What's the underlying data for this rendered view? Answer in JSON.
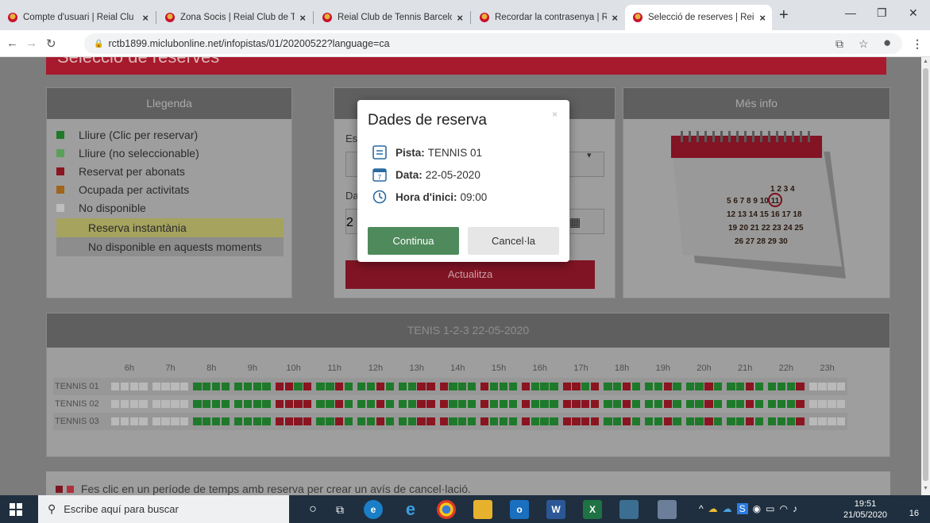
{
  "browser": {
    "tabs": [
      {
        "title": "Compte d'usuari | Reial Clu",
        "active": false
      },
      {
        "title": "Zona Socis | Reial Club de T",
        "active": false
      },
      {
        "title": "Reial Club de Tennis Barcelo",
        "active": false
      },
      {
        "title": "Recordar la contrasenya | Re",
        "active": false
      },
      {
        "title": "Selecció de reserves | Reial",
        "active": true
      }
    ],
    "url": "rctb1899.miclubonline.net/infopistas/01/20200522?language=ca"
  },
  "page": {
    "title": "Selecció de reserves",
    "legend": {
      "heading": "Llegenda",
      "items": [
        {
          "label": "Lliure (Clic per reservar)",
          "color": "#1e7a2a"
        },
        {
          "label": "Lliure (no seleccionable)",
          "color": "#5aa05a"
        },
        {
          "label": "Reservat per abonats",
          "color": "#8a1420"
        },
        {
          "label": "Ocupada per activitats",
          "color": "#a0641c"
        },
        {
          "label": "No disponible",
          "color": "#bdbdbd"
        }
      ],
      "instant": "Reserva instantània",
      "unavailable_now": "No disponible en aquests moments"
    },
    "filters": {
      "label1": "Es",
      "label2": "Da",
      "date_prefix": "2",
      "update_button": "Actualitza"
    },
    "info": {
      "heading": "Més info"
    },
    "schedule": {
      "heading": "TENIS 1-2-3 22-05-2020",
      "hours": [
        "6h",
        "7h",
        "8h",
        "9h",
        "10h",
        "11h",
        "12h",
        "13h",
        "14h",
        "15h",
        "16h",
        "17h",
        "18h",
        "19h",
        "20h",
        "21h",
        "22h",
        "23h"
      ],
      "courts": [
        {
          "name": "TENNIS 01",
          "slots": [
            "nnnn",
            "nnnn",
            "ffff",
            "ffff",
            "rrfr",
            "ffrf",
            "ffrf",
            "ffrr",
            "rfff",
            "rfff",
            "rfff",
            "rrfr",
            "ffrf",
            "ffrf",
            "ffrf",
            "ffrf",
            "fffr",
            "nnnn"
          ]
        },
        {
          "name": "TENNIS 02",
          "slots": [
            "nnnn",
            "nnnn",
            "ffff",
            "ffff",
            "rrrr",
            "ffrf",
            "ffrf",
            "ffrr",
            "rfff",
            "rfff",
            "rfff",
            "rrrr",
            "ffrf",
            "ffrf",
            "ffrf",
            "ffrf",
            "fffr",
            "nnnn"
          ]
        },
        {
          "name": "TENNIS 03",
          "slots": [
            "nnnn",
            "nnnn",
            "ffff",
            "ffff",
            "rrrr",
            "ffrf",
            "ffrf",
            "ffrr",
            "rfff",
            "rfff",
            "rfff",
            "rrrr",
            "ffrf",
            "ffrf",
            "ffrf",
            "ffrf",
            "fffr",
            "nnnn"
          ]
        }
      ]
    },
    "note": "Fes clic en un període de temps amb reserva per crear un avís de cancel·lació."
  },
  "modal": {
    "title": "Dades de reserva",
    "close": "×",
    "court_label": "Pista:",
    "court_value": "TENNIS 01",
    "date_label": "Data:",
    "date_value": "22-05-2020",
    "time_label": "Hora d'inici:",
    "time_value": "09:00",
    "continue_button": "Continua",
    "cancel_button": "Cancel·la"
  },
  "taskbar": {
    "search_placeholder": "Escribe aquí para buscar",
    "time": "19:51",
    "date": "21/05/2020",
    "notifications": "16"
  },
  "colors": {
    "free": "#1e7a2a",
    "reserved": "#8a1420",
    "unavailable": "#b9b9b9",
    "accent": "#a7192c",
    "continue": "#4f8a5c"
  }
}
